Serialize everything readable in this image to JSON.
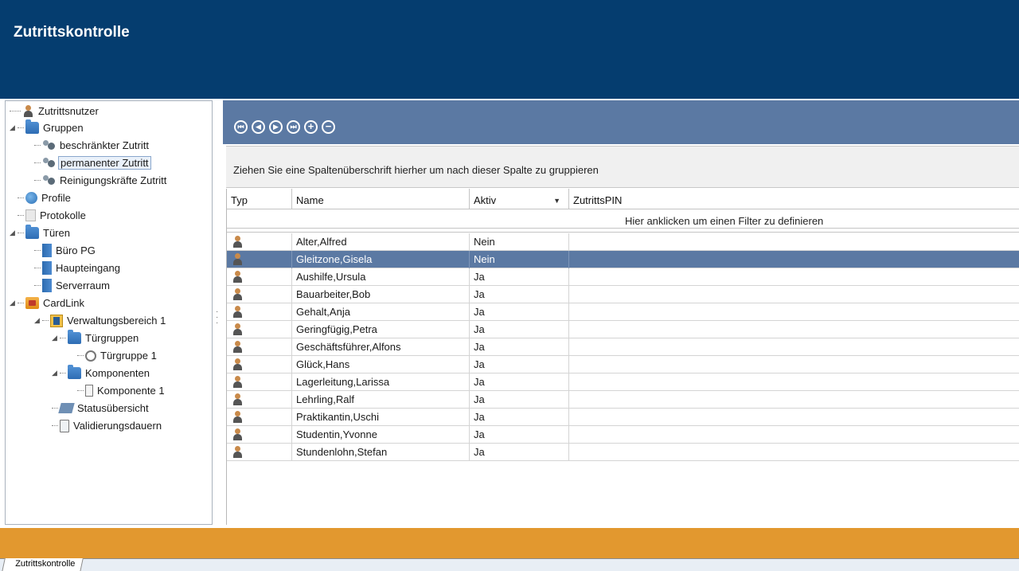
{
  "app": {
    "title": "Zutrittskontrolle"
  },
  "tree": {
    "zutrittsnutzer": "Zutrittsnutzer",
    "gruppen": "Gruppen",
    "beschraenkter": "beschränkter Zutritt",
    "permanenter": "permanenter Zutritt",
    "reinigung": "Reinigungskräfte Zutritt",
    "profile": "Profile",
    "protokolle": "Protokolle",
    "tueren": "Türen",
    "buero": "Büro PG",
    "haupteingang": "Haupteingang",
    "serverraum": "Serverraum",
    "cardlink": "CardLink",
    "verwaltung": "Verwaltungsbereich 1",
    "tuergruppen": "Türgruppen",
    "tuergruppe1": "Türgruppe 1",
    "komponenten": "Komponenten",
    "komponente1": "Komponente 1",
    "status": "Statusübersicht",
    "validierung": "Validierungsdauern"
  },
  "grid": {
    "group_hint": "Ziehen Sie eine Spaltenüberschrift hierher um nach dieser Spalte zu gruppieren",
    "columns": {
      "typ": "Typ",
      "name": "Name",
      "aktiv": "Aktiv",
      "pin": "ZutrittsPIN"
    },
    "filter_hint": "Hier anklicken um einen Filter zu definieren",
    "rows": [
      {
        "name": "Alter,Alfred",
        "aktiv": "Nein"
      },
      {
        "name": "Gleitzone,Gisela",
        "aktiv": "Nein"
      },
      {
        "name": "Aushilfe,Ursula",
        "aktiv": "Ja"
      },
      {
        "name": "Bauarbeiter,Bob",
        "aktiv": "Ja"
      },
      {
        "name": "Gehalt,Anja",
        "aktiv": "Ja"
      },
      {
        "name": "Geringfügig,Petra",
        "aktiv": "Ja"
      },
      {
        "name": "Geschäftsführer,Alfons",
        "aktiv": "Ja"
      },
      {
        "name": "Glück,Hans",
        "aktiv": "Ja"
      },
      {
        "name": "Lagerleitung,Larissa",
        "aktiv": "Ja"
      },
      {
        "name": "Lehrling,Ralf",
        "aktiv": "Ja"
      },
      {
        "name": "Praktikantin,Uschi",
        "aktiv": "Ja"
      },
      {
        "name": "Studentin,Yvonne",
        "aktiv": "Ja"
      },
      {
        "name": "Stundenlohn,Stefan",
        "aktiv": "Ja"
      }
    ]
  },
  "tabs": {
    "active": "Zutrittskontrolle"
  },
  "colors": {
    "header": "#053d6f",
    "toolbar": "#5b79a3",
    "band": "#e2982f",
    "selection": "#5b79a3"
  }
}
